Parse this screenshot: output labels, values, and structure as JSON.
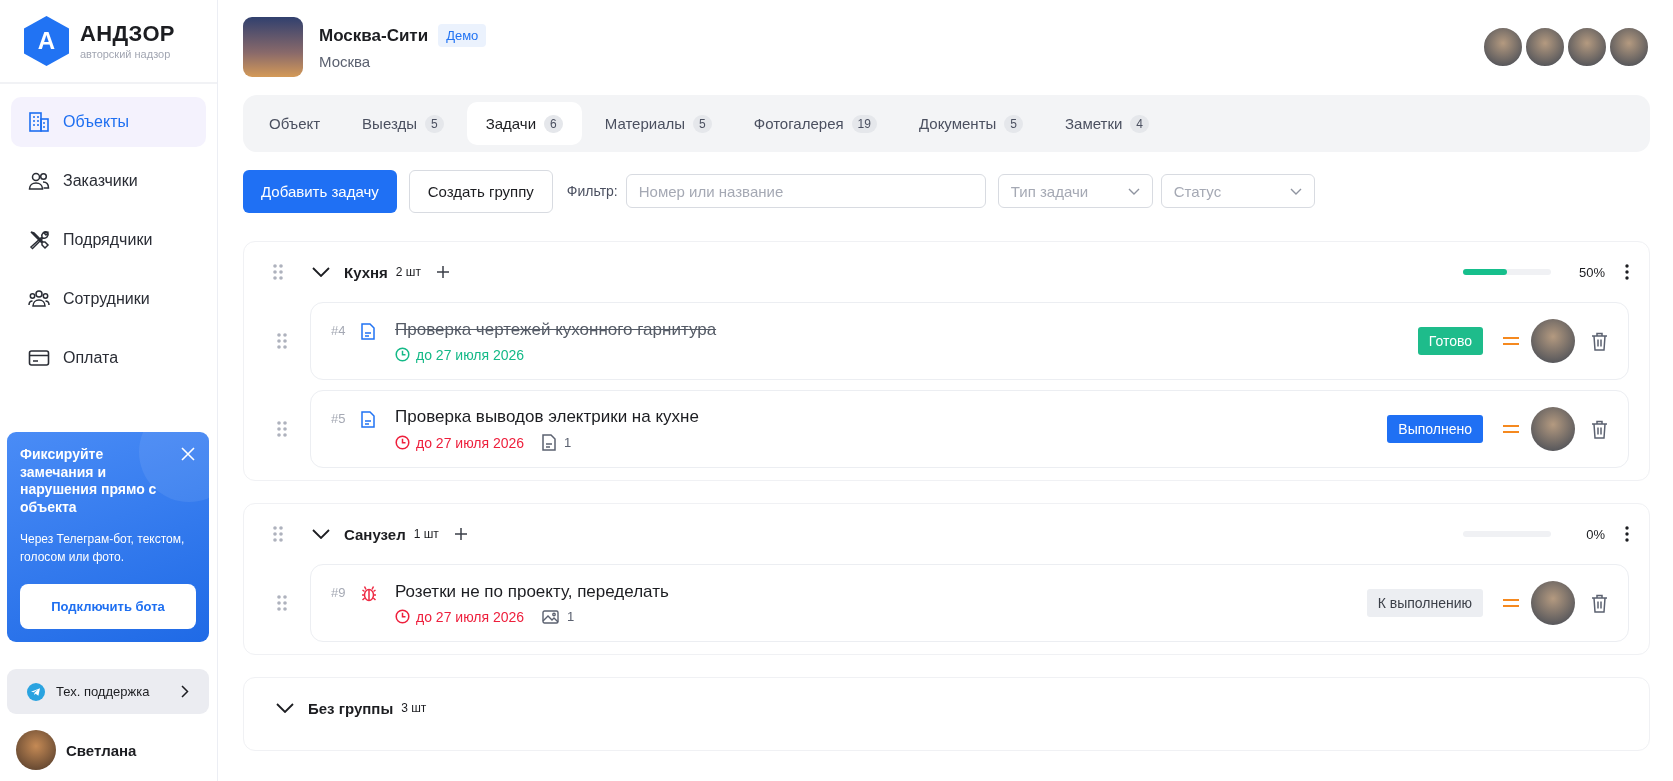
{
  "sidebar": {
    "logo": {
      "letter": "А",
      "name": "АНДЗОР",
      "tagline": "авторский надзор"
    },
    "nav": [
      {
        "label": "Объекты",
        "kind": "building",
        "selected": true
      },
      {
        "label": "Заказчики",
        "kind": "users",
        "selected": false
      },
      {
        "label": "Подрядчики",
        "kind": "tools",
        "selected": false
      },
      {
        "label": "Сотрудники",
        "kind": "team",
        "selected": false
      },
      {
        "label": "Оплата",
        "kind": "card",
        "selected": false
      }
    ],
    "promo": {
      "title": "Фиксируйте замечания и нарушения прямо с объекта",
      "text": "Через Телеграм-бот, текстом, голосом или фото.",
      "button": "Подключить бота"
    },
    "support": {
      "label": "Тех. поддержка"
    },
    "user": {
      "name": "Светлана"
    }
  },
  "header": {
    "title": "Москва-Сити",
    "badge": "Демо",
    "city": "Москва"
  },
  "tabs": [
    {
      "label": "Объект",
      "selected": false
    },
    {
      "label": "Выезды",
      "count": "5",
      "selected": false
    },
    {
      "label": "Задачи",
      "count": "6",
      "selected": true
    },
    {
      "label": "Материалы",
      "count": "5",
      "selected": false
    },
    {
      "label": "Фотогалерея",
      "count": "19",
      "selected": false
    },
    {
      "label": "Документы",
      "count": "5",
      "selected": false
    },
    {
      "label": "Заметки",
      "count": "4",
      "selected": false
    }
  ],
  "toolbar": {
    "add_button": "Добавить задачу",
    "group_button": "Создать группу",
    "filter_label": "Фильтр:",
    "search": {
      "placeholder": "Номер или название"
    },
    "dropdowns": [
      {
        "placeholder": "Тип задачи"
      },
      {
        "placeholder": "Статус"
      }
    ]
  },
  "groups": [
    {
      "title": "Кухня",
      "count": "2 шт",
      "expanded": true,
      "draggable": true,
      "progress": {
        "level": 0.5,
        "reading": "50%"
      },
      "tasks": [
        {
          "number": "#4",
          "kind": "document",
          "title": "Проверка чертежей кухонного гарнитура",
          "struck": true,
          "due": "до 27 июля 2026",
          "overdue": false,
          "status": {
            "label": "Готово",
            "kind": "ready"
          }
        },
        {
          "number": "#5",
          "kind": "document",
          "title": "Проверка выводов электрики на кухне",
          "struck": false,
          "due": "до 27 июля 2026",
          "overdue": true,
          "attachment": {
            "kind": "document",
            "count": "1"
          },
          "status": {
            "label": "Выполнено",
            "kind": "done"
          }
        }
      ]
    },
    {
      "title": "Санузел",
      "count": "1 шт",
      "expanded": true,
      "draggable": true,
      "progress": {
        "level": 0,
        "reading": "0%"
      },
      "tasks": [
        {
          "number": "#9",
          "kind": "bug",
          "title": "Розетки не по проекту, переделать",
          "struck": false,
          "due": "до 27 июля 2026",
          "overdue": true,
          "attachment": {
            "kind": "image",
            "count": "1"
          },
          "status": {
            "label": "К выполнению",
            "kind": "todo"
          }
        }
      ]
    },
    {
      "title": "Без группы",
      "count": "3 шт",
      "expanded": true,
      "draggable": false
    }
  ]
}
